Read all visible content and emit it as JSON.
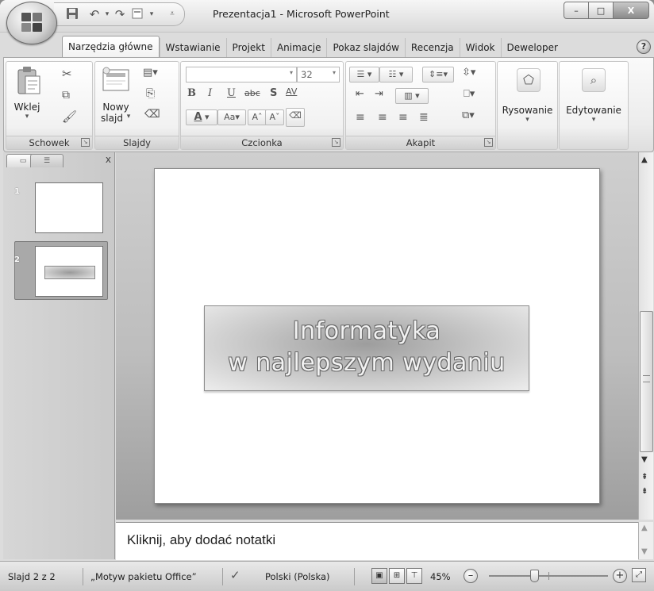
{
  "window": {
    "title": "Prezentacja1 - Microsoft PowerPoint",
    "minimize": "–",
    "maximize": "□",
    "close": "X"
  },
  "quick_access": {
    "save_icon": "save-icon",
    "undo_icon": "undo-icon",
    "redo_icon": "redo-icon",
    "customize_icon": "customize-icon"
  },
  "tabs": [
    {
      "label": "Narzędzia główne",
      "active": true
    },
    {
      "label": "Wstawianie"
    },
    {
      "label": "Projekt"
    },
    {
      "label": "Animacje"
    },
    {
      "label": "Pokaz slajdów"
    },
    {
      "label": "Recenzja"
    },
    {
      "label": "Widok"
    },
    {
      "label": "Deweloper"
    }
  ],
  "ribbon": {
    "clipboard": {
      "label": "Schowek",
      "paste_label": "Wklej"
    },
    "slides": {
      "label": "Slajdy",
      "new_slide_line1": "Nowy",
      "new_slide_line2": "slajd"
    },
    "font": {
      "label": "Czcionka",
      "font_name": "",
      "font_size": "32",
      "bold": "B",
      "italic": "I",
      "underline": "U",
      "strikethrough": "abc",
      "shadow": "S",
      "spacing": "AV",
      "case": "Aa",
      "grow": "Aˆ",
      "shrink": "Aˇ"
    },
    "paragraph": {
      "label": "Akapit"
    },
    "drawing": {
      "label": "Rysowanie"
    },
    "editing": {
      "label": "Edytowanie"
    }
  },
  "slides_pane": {
    "thumbnails": [
      {
        "number": "1"
      },
      {
        "number": "2",
        "selected": true
      }
    ]
  },
  "slide": {
    "title_line1": "Informatyka",
    "title_line2": "w najlepszym wydaniu"
  },
  "notes": {
    "placeholder": "Kliknij, aby dodać notatki"
  },
  "status_bar": {
    "slide_counter": "Slajd 2 z 2",
    "theme": "„Motyw pakietu Office”",
    "language": "Polski (Polska)",
    "zoom": "45%"
  }
}
